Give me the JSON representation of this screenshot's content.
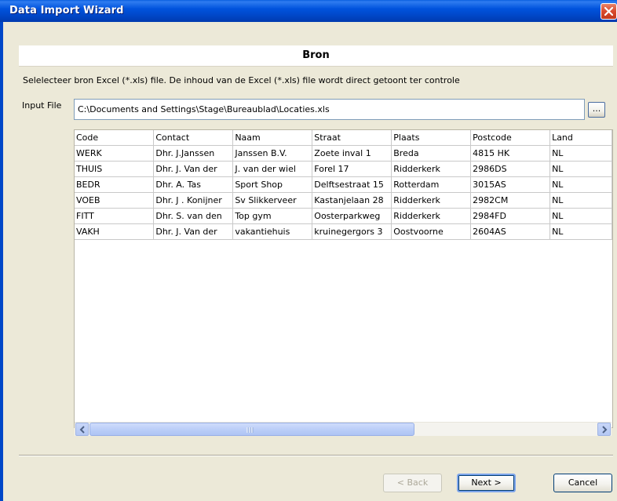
{
  "window": {
    "title": "Data Import Wizard"
  },
  "header": {
    "title": "Bron"
  },
  "description": "Selelecteer bron Excel (*.xls) file. De inhoud van de Excel (*.xls) file wordt direct getoont ter controle",
  "input_file": {
    "label": "Input File",
    "value": "C:\\Documents and Settings\\Stage\\Bureaublad\\Locaties.xls",
    "browse_label": "..."
  },
  "table": {
    "columns": [
      "Code",
      "Contact",
      "Naam",
      "Straat",
      "Plaats",
      "Postcode",
      "Land"
    ],
    "rows": [
      [
        "WERK",
        "Dhr. J.Janssen",
        "Janssen B.V.",
        "Zoete inval 1",
        "Breda",
        "4815 HK",
        "NL"
      ],
      [
        "THUIS",
        "Dhr. J. Van der",
        "J. van der wiel",
        "Forel 17",
        "Ridderkerk",
        "2986DS",
        "NL"
      ],
      [
        "BEDR",
        "Dhr. A. Tas",
        "Sport Shop",
        "Delftsestraat 15",
        "Rotterdam",
        "3015AS",
        "NL"
      ],
      [
        "VOEB",
        "Dhr. J . Konijner",
        "Sv Slikkerveer",
        "Kastanjelaan 28",
        "Ridderkerk",
        "2982CM",
        "NL"
      ],
      [
        "FITT",
        "Dhr. S. van den",
        "Top gym",
        "Oosterparkweg",
        "Ridderkerk",
        "2984FD",
        "NL"
      ],
      [
        "VAKH",
        "Dhr. J. Van der",
        "vakantiehuis",
        "kruinegergors 3",
        "Oostvoorne",
        "2604AS",
        "NL"
      ]
    ]
  },
  "buttons": {
    "back": "< Back",
    "next": "Next >",
    "cancel": "Cancel"
  },
  "icons": {
    "close": "close-icon",
    "scroll_left": "chevron-left-icon",
    "scroll_right": "chevron-right-icon"
  },
  "colors": {
    "titlebar": "#0053dd",
    "dialog_bg": "#ece9d8",
    "close_button": "#d9492c"
  }
}
